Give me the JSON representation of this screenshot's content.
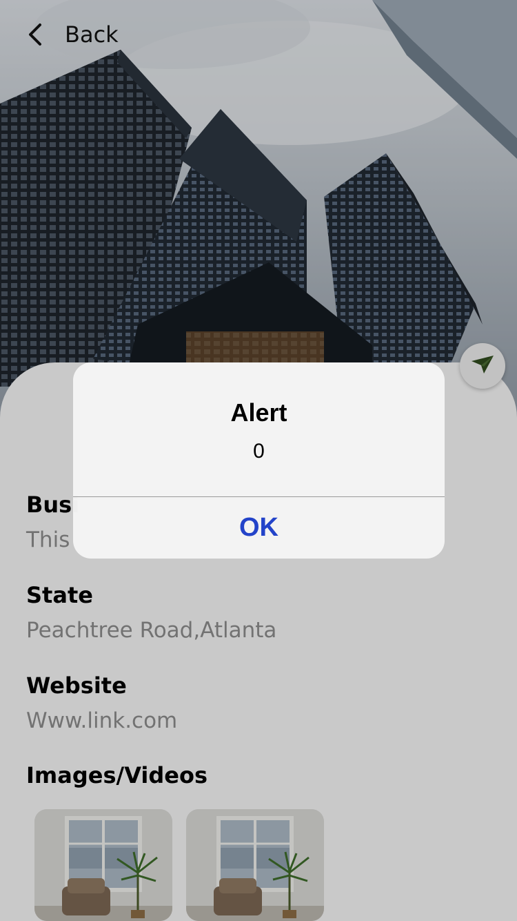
{
  "nav": {
    "back_label": "Back"
  },
  "details": {
    "business_label": "Busi",
    "business_value": "This",
    "state_label": "State",
    "state_value": "Peachtree Road,Atlanta",
    "website_label": "Website",
    "website_value": "Www.link.com",
    "media_label": "Images/Videos"
  },
  "media": [
    {
      "icon": "room-photo-thumbnail"
    },
    {
      "icon": "room-photo-thumbnail"
    }
  ],
  "alert": {
    "title": "Alert",
    "message": "0",
    "ok_label": "OK"
  },
  "colors": {
    "sheet_bg": "#f2f2f2",
    "label": "#000000",
    "value": "#8a8a8a",
    "alert_button": "#2343c9",
    "send_icon": "#2f4a1e"
  }
}
